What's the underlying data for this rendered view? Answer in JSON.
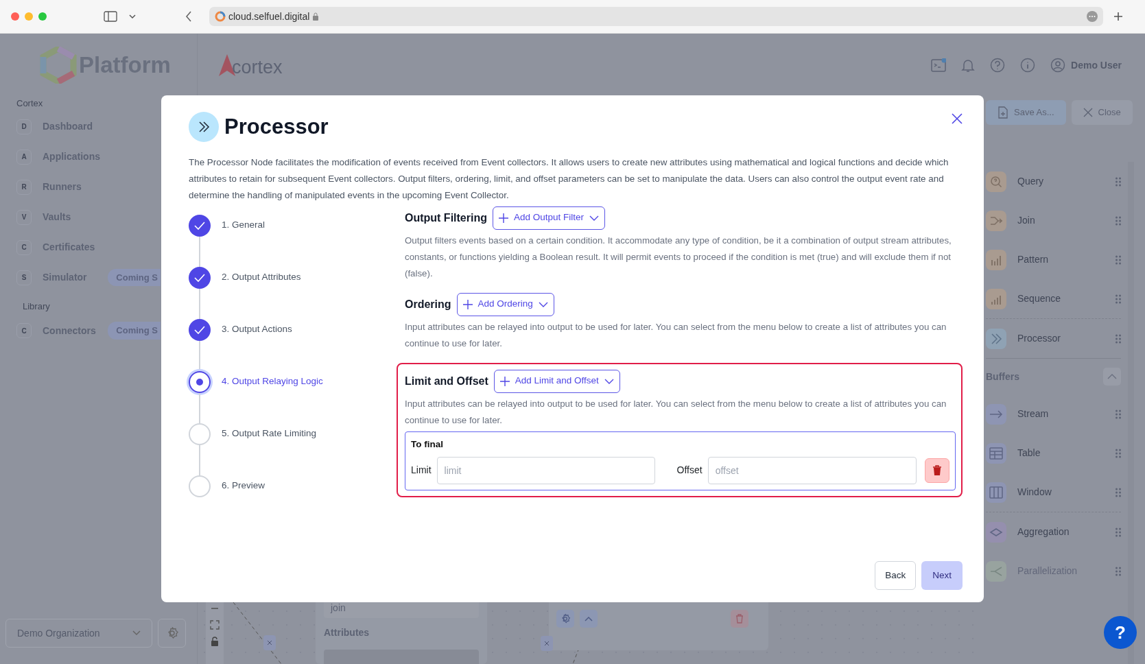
{
  "browser": {
    "url": "cloud.selfuel.digital"
  },
  "header": {
    "logo": "Platform",
    "product": "cortex",
    "user": "Demo User"
  },
  "sidebar": {
    "sections": [
      {
        "title": "Cortex",
        "items": [
          {
            "letter": "D",
            "label": "Dashboard"
          },
          {
            "letter": "A",
            "label": "Applications"
          },
          {
            "letter": "R",
            "label": "Runners"
          },
          {
            "letter": "V",
            "label": "Vaults"
          },
          {
            "letter": "C",
            "label": "Certificates"
          },
          {
            "letter": "S",
            "label": "Simulator",
            "badge": "Coming S"
          }
        ]
      },
      {
        "title": "Library",
        "items": [
          {
            "letter": "C",
            "label": "Connectors",
            "badge": "Coming S"
          }
        ]
      }
    ],
    "organization": "Demo Organization"
  },
  "toolbar": {
    "buttons": [
      {
        "label": "Save As...",
        "kind": "save"
      },
      {
        "label": "Close",
        "kind": "close"
      }
    ]
  },
  "palette": {
    "groups": [
      {
        "items": [
          {
            "label": "Query",
            "kind": "query",
            "color": "#a99b90",
            "disabled": false
          },
          {
            "label": "Join",
            "kind": "join",
            "color": "#a99b90",
            "disabled": false
          },
          {
            "label": "Pattern",
            "kind": "pattern",
            "color": "#a99b90",
            "disabled": false
          },
          {
            "label": "Sequence",
            "kind": "sequence",
            "color": "#a99b90",
            "disabled": false
          }
        ]
      },
      {
        "items": [
          {
            "label": "Processor",
            "kind": "processor",
            "color": "#8fa2b4",
            "disabled": false
          }
        ]
      },
      {
        "title": "Buffers",
        "expanded": true,
        "items": [
          {
            "label": "Stream",
            "kind": "stream",
            "color": "#8e95b3",
            "disabled": false
          },
          {
            "label": "Table",
            "kind": "table",
            "color": "#8e95b3",
            "disabled": false
          },
          {
            "label": "Window",
            "kind": "window",
            "color": "#8e95b3",
            "disabled": false
          }
        ]
      },
      {
        "items": [
          {
            "label": "Aggregation",
            "kind": "aggregation",
            "color": "#958fae",
            "disabled": false
          },
          {
            "label": "Parallelization",
            "kind": "parallelization",
            "color": "#8fa69e",
            "disabled": true
          }
        ]
      }
    ]
  },
  "canvas": {
    "node_name": "join",
    "section": "Attributes"
  },
  "modal": {
    "title": "Processor",
    "description": "The Processor Node facilitates the modification of events received from Event collectors. It allows users to create new attributes using mathematical and logical functions and decide which attributes to retain for subsequent Event collectors. Output filters, ordering, limit, and offset parameters can be set to manipulate the data. Users can also control the output event rate and determine the handling of manipulated events in the upcoming Event Collector.",
    "steps": [
      {
        "label": "1. General",
        "completed": true,
        "selected": false
      },
      {
        "label": "2. Output Attributes",
        "completed": true,
        "selected": false
      },
      {
        "label": "3. Output Actions",
        "completed": true,
        "selected": false
      },
      {
        "label": "4. Output Relaying Logic",
        "completed": false,
        "selected": true
      },
      {
        "label": "5. Output Rate Limiting",
        "completed": false,
        "selected": false
      },
      {
        "label": "6. Preview",
        "completed": false,
        "selected": false
      }
    ],
    "sections": [
      {
        "title": "Output Filtering",
        "button": "Add Output Filter",
        "highlighted": false,
        "description": "Output filters events based on a certain condition. It accommodate any type of condition, be it a combination of output stream attributes, constants, or functions yielding a Boolean result. It will permit events to proceed if the condition is met (true) and will exclude them if not (false)."
      },
      {
        "title": "Ordering",
        "button": "Add Ordering",
        "highlighted": false,
        "description": "Input attributes can be relayed into output to be used for later. You can select from the menu below to create a list of attributes you can continue to use for later."
      },
      {
        "title": "Limit and Offset",
        "button": "Add Limit and Offset",
        "highlighted": true,
        "description": "Input attributes can be relayed into output to be used for later. You can select from the menu below to create a list of attributes you can continue to use for later.",
        "entries": [
          {
            "title": "To final",
            "limit_label": "Limit",
            "limit_placeholder": "limit",
            "offset_label": "Offset",
            "offset_placeholder": "offset"
          }
        ]
      }
    ],
    "buttons": [
      {
        "label": "Back",
        "kind": "secondary"
      },
      {
        "label": "Next",
        "kind": "primary"
      }
    ]
  },
  "help_button": "?"
}
